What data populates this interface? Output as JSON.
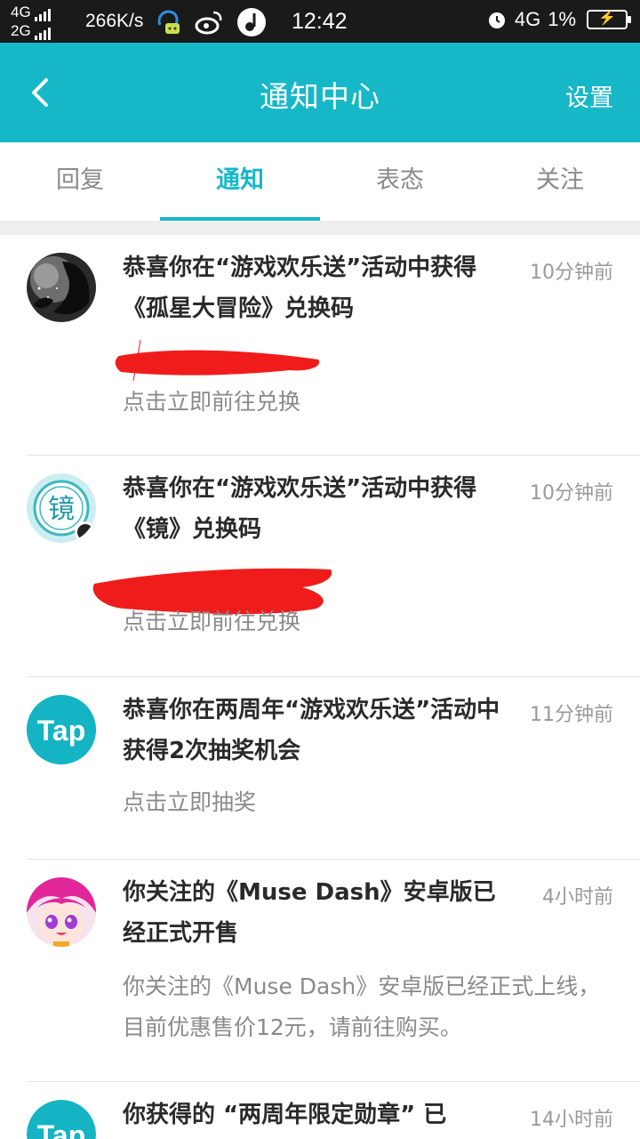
{
  "status_bar": {
    "net1": "4G",
    "net2": "2G",
    "speed": "266K/s",
    "time": "12:42",
    "net_right": "4G",
    "battery_pct": "1%"
  },
  "header": {
    "title": "通知中心",
    "settings_label": "设置",
    "back_icon": "chevron-left-icon"
  },
  "tabs": [
    {
      "label": "回复",
      "active": false
    },
    {
      "label": "通知",
      "active": true
    },
    {
      "label": "表态",
      "active": false
    },
    {
      "label": "关注",
      "active": false
    }
  ],
  "notifications": [
    {
      "title": "恭喜你在“游戏欢乐送”活动中获得《孤星大冒险》兑换码",
      "time": "10分钟前",
      "subtitle": "点击立即前往兑换",
      "avatar": "dark-anime-avatar-icon"
    },
    {
      "title": "恭喜你在“游戏欢乐送”活动中获得《镜》兑换码",
      "time": "10分钟前",
      "subtitle": "点击立即前往兑换",
      "avatar": "jing-game-avatar-icon",
      "avatar_text": "镜"
    },
    {
      "title": "恭喜你在两周年“游戏欢乐送”活动中获得2次抽奖机会",
      "time": "11分钟前",
      "subtitle": "点击立即抽奖",
      "avatar": "tap-logo-icon",
      "avatar_text": "Tap"
    },
    {
      "title": "你关注的《Muse Dash》安卓版已经正式开售",
      "time": "4小时前",
      "subtitle": "你关注的《Muse Dash》安卓版已经正式上线，目前优惠售价12元，请前往购买。",
      "avatar": "muse-dash-avatar-icon"
    },
    {
      "title": "你获得的 “两周年限定勋章” 已",
      "time": "14小时前",
      "avatar": "tap-logo-icon",
      "avatar_text": "Tap"
    }
  ],
  "colors": {
    "accent": "#16b8c8",
    "status_bar": "#1a1a1a",
    "redaction": "#f01c1c"
  }
}
